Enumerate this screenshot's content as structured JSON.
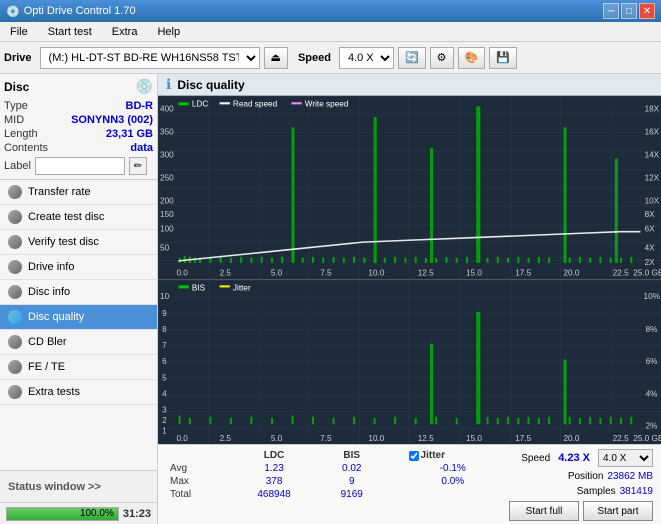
{
  "app": {
    "title": "Opti Drive Control 1.70",
    "icon": "💿"
  },
  "titlebar": {
    "title": "Opti Drive Control 1.70",
    "minimize": "─",
    "maximize": "□",
    "close": "✕"
  },
  "menu": {
    "items": [
      "File",
      "Start test",
      "Extra",
      "Help"
    ]
  },
  "toolbar": {
    "drive_label": "Drive",
    "drive_value": "(M:)  HL-DT-ST BD-RE  WH16NS58 TST4",
    "speed_label": "Speed",
    "speed_value": "4.0 X"
  },
  "disc": {
    "section_label": "Disc",
    "type_label": "Type",
    "type_value": "BD-R",
    "mid_label": "MID",
    "mid_value": "SONYNN3 (002)",
    "length_label": "Length",
    "length_value": "23,31 GB",
    "contents_label": "Contents",
    "contents_value": "data",
    "label_label": "Label"
  },
  "nav": {
    "items": [
      {
        "id": "transfer-rate",
        "label": "Transfer rate",
        "active": false
      },
      {
        "id": "create-test-disc",
        "label": "Create test disc",
        "active": false
      },
      {
        "id": "verify-test-disc",
        "label": "Verify test disc",
        "active": false
      },
      {
        "id": "drive-info",
        "label": "Drive info",
        "active": false
      },
      {
        "id": "disc-info",
        "label": "Disc info",
        "active": false
      },
      {
        "id": "disc-quality",
        "label": "Disc quality",
        "active": true
      },
      {
        "id": "cd-bler",
        "label": "CD Bler",
        "active": false
      },
      {
        "id": "fe-te",
        "label": "FE / TE",
        "active": false
      },
      {
        "id": "extra-tests",
        "label": "Extra tests",
        "active": false
      }
    ]
  },
  "status_bar": {
    "label": "Status window >>",
    "progress": 100,
    "progress_text": "100.0%",
    "time": "31:23"
  },
  "dq": {
    "title": "Disc quality",
    "chart1": {
      "legend": [
        {
          "label": "LDC",
          "color": "#00cc00"
        },
        {
          "label": "Read speed",
          "color": "#ffffff"
        },
        {
          "label": "Write speed",
          "color": "#ff66ff"
        }
      ],
      "y_max": 400,
      "x_max": 25
    },
    "chart2": {
      "legend": [
        {
          "label": "BIS",
          "color": "#00cc00"
        },
        {
          "label": "Jitter",
          "color": "#ffff00"
        }
      ],
      "y_max": 10,
      "x_max": 25
    }
  },
  "stats": {
    "headers": [
      "LDC",
      "BIS",
      "",
      "Jitter",
      "Speed",
      ""
    ],
    "avg_label": "Avg",
    "avg_ldc": "1.23",
    "avg_bis": "0.02",
    "avg_jitter": "-0.1%",
    "max_label": "Max",
    "max_ldc": "378",
    "max_bis": "9",
    "max_jitter": "0.0%",
    "total_label": "Total",
    "total_ldc": "468948",
    "total_bis": "9169",
    "speed_label": "Speed",
    "speed_value": "4.23 X",
    "speed_select": "4.0 X",
    "position_label": "Position",
    "position_value": "23862 MB",
    "samples_label": "Samples",
    "samples_value": "381419",
    "start_full_label": "Start full",
    "start_part_label": "Start part",
    "jitter_checked": true,
    "jitter_label": "Jitter"
  }
}
